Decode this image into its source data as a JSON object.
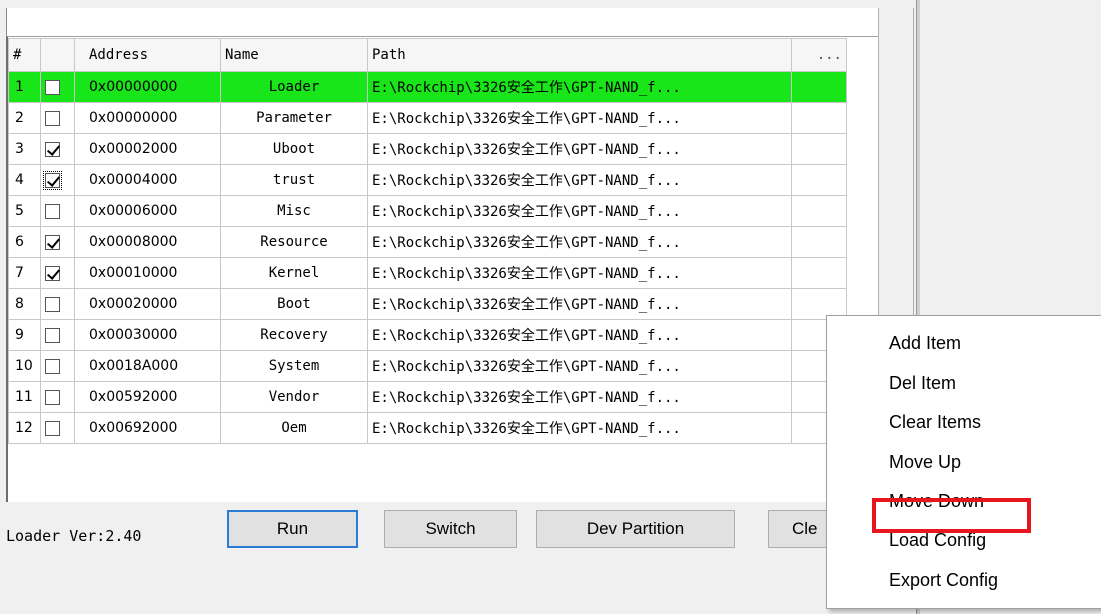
{
  "table": {
    "headers": [
      "#",
      "",
      "Address",
      "Name",
      "Path",
      "..."
    ],
    "rows": [
      {
        "num": "1",
        "checked": false,
        "address": "0x00000000",
        "name": "Loader",
        "path": "E:\\Rockchip\\3326安全工作\\GPT-NAND_f..."
      },
      {
        "num": "2",
        "checked": false,
        "address": "0x00000000",
        "name": "Parameter",
        "path": "E:\\Rockchip\\3326安全工作\\GPT-NAND_f..."
      },
      {
        "num": "3",
        "checked": true,
        "address": "0x00002000",
        "name": "Uboot",
        "path": "E:\\Rockchip\\3326安全工作\\GPT-NAND_f..."
      },
      {
        "num": "4",
        "checked": true,
        "address": "0x00004000",
        "name": "trust",
        "path": "E:\\Rockchip\\3326安全工作\\GPT-NAND_f..."
      },
      {
        "num": "5",
        "checked": false,
        "address": "0x00006000",
        "name": "Misc",
        "path": "E:\\Rockchip\\3326安全工作\\GPT-NAND_f..."
      },
      {
        "num": "6",
        "checked": true,
        "address": "0x00008000",
        "name": "Resource",
        "path": "E:\\Rockchip\\3326安全工作\\GPT-NAND_f..."
      },
      {
        "num": "7",
        "checked": true,
        "address": "0x00010000",
        "name": "Kernel",
        "path": "E:\\Rockchip\\3326安全工作\\GPT-NAND_f..."
      },
      {
        "num": "8",
        "checked": false,
        "address": "0x00020000",
        "name": "Boot",
        "path": "E:\\Rockchip\\3326安全工作\\GPT-NAND_f..."
      },
      {
        "num": "9",
        "checked": false,
        "address": "0x00030000",
        "name": "Recovery",
        "path": "E:\\Rockchip\\3326安全工作\\GPT-NAND_f..."
      },
      {
        "num": "10",
        "checked": false,
        "address": "0x0018A000",
        "name": "System",
        "path": "E:\\Rockchip\\3326安全工作\\GPT-NAND_f..."
      },
      {
        "num": "11",
        "checked": false,
        "address": "0x00592000",
        "name": "Vendor",
        "path": "E:\\Rockchip\\3326安全工作\\GPT-NAND_f..."
      },
      {
        "num": "12",
        "checked": false,
        "address": "0x00692000",
        "name": "Oem",
        "path": "E:\\Rockchip\\3326安全工作\\GPT-NAND_f..."
      }
    ],
    "selected_row": "1",
    "selected_color": "#19e619"
  },
  "status": {
    "loader_ver": "Loader Ver:2.40"
  },
  "buttons": {
    "run": "Run",
    "switch": "Switch",
    "dev_partition": "Dev Partition",
    "clear": "Cle"
  },
  "context_menu": {
    "items": [
      "Add Item",
      "Del Item",
      "Clear Items",
      "Move Up",
      "Move Down",
      "Load Config",
      "Export Config"
    ],
    "highlighted": "Load Config",
    "highlight_color": "#e8141e"
  }
}
